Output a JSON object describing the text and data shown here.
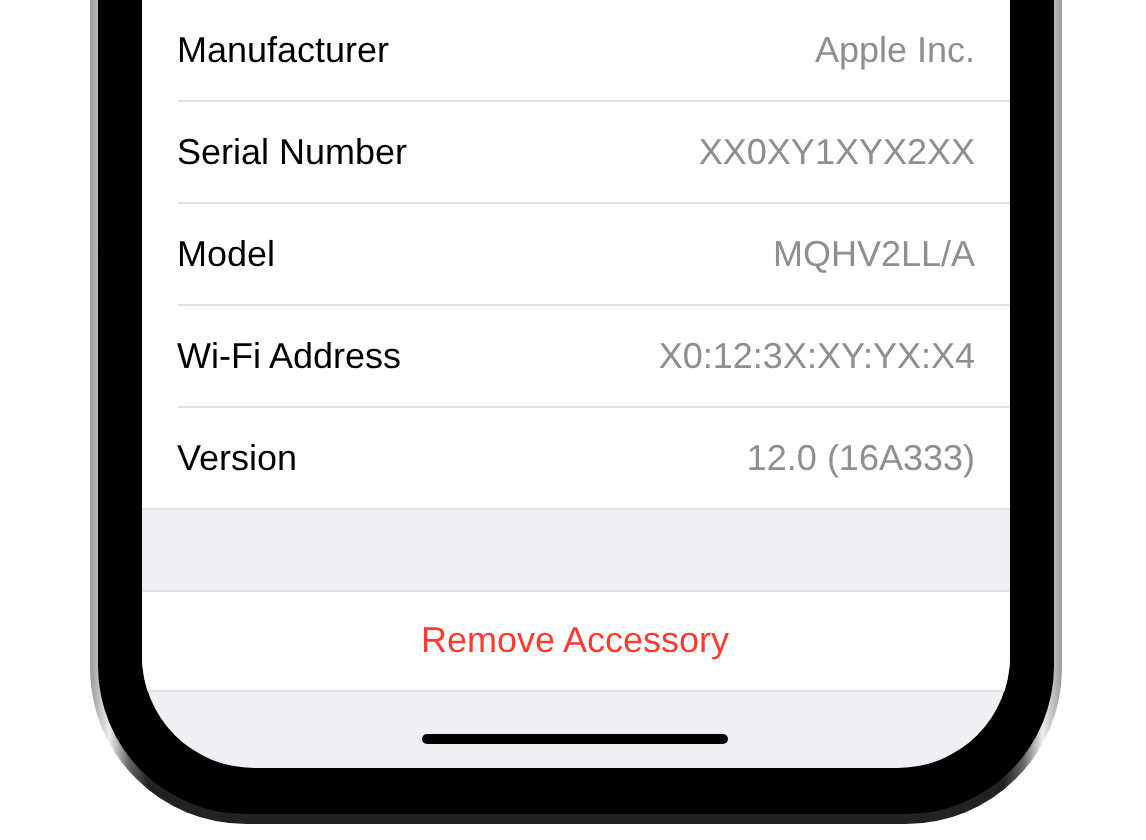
{
  "rows": [
    {
      "label": "Manufacturer",
      "value": "Apple Inc."
    },
    {
      "label": "Serial Number",
      "value": "XX0XY1XYX2XX"
    },
    {
      "label": "Model",
      "value": "MQHV2LL/A"
    },
    {
      "label": "Wi-Fi Address",
      "value": "X0:12:3X:XY:YX:X4"
    },
    {
      "label": "Version",
      "value": "12.0 (16A333)"
    }
  ],
  "action": {
    "label": "Remove Accessory",
    "kind": "destructive"
  }
}
